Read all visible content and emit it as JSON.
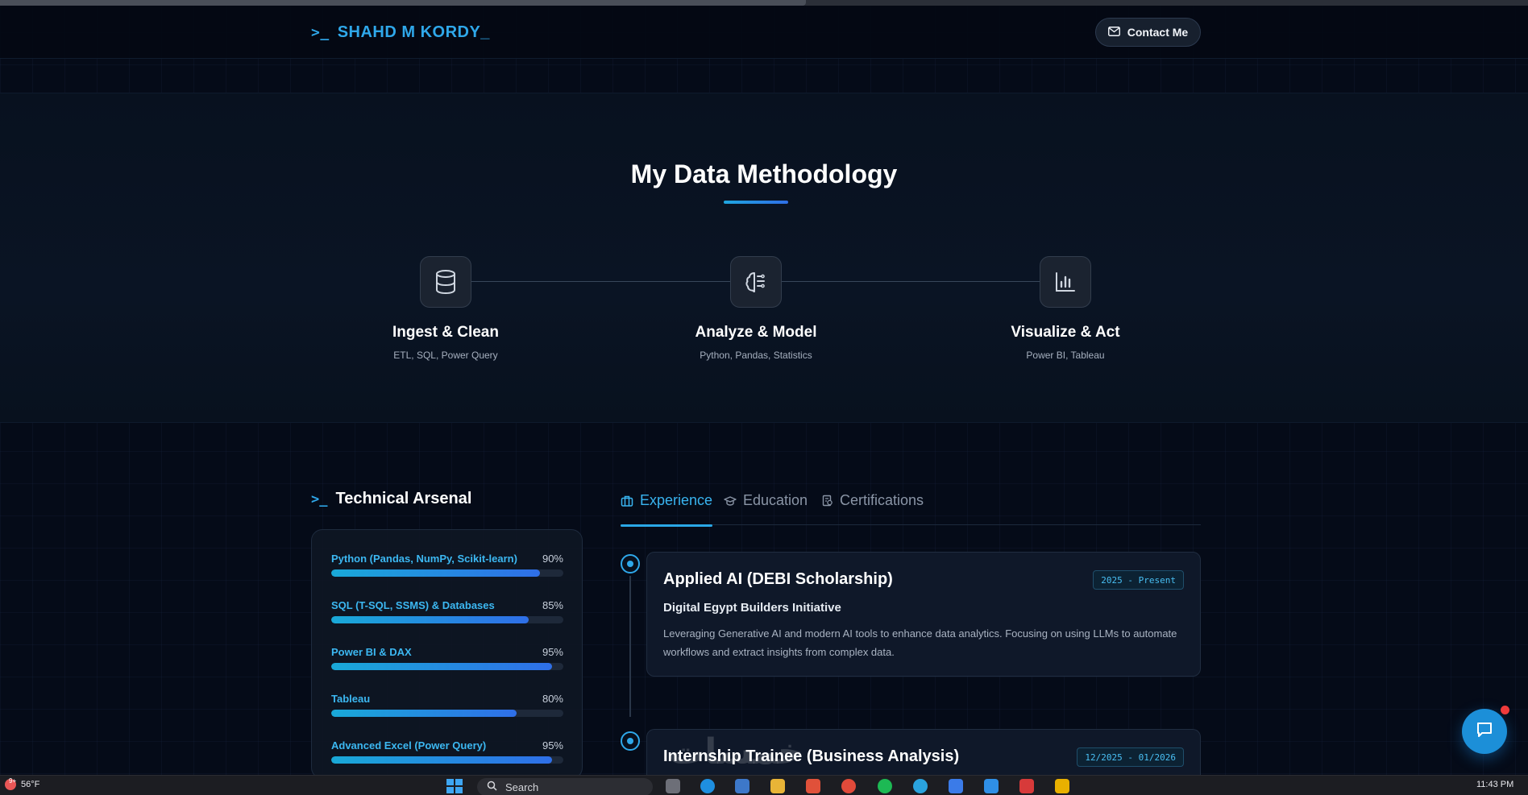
{
  "header": {
    "logo_prompt": ">_",
    "logo_text": "SHAHD M KORDY_",
    "contact_label": "Contact Me"
  },
  "methodology": {
    "title": "My Data Methodology",
    "steps": [
      {
        "title": "Ingest & Clean",
        "subtitle": "ETL, SQL, Power Query",
        "icon": "database-icon"
      },
      {
        "title": "Analyze & Model",
        "subtitle": "Python, Pandas, Statistics",
        "icon": "brain-icon"
      },
      {
        "title": "Visualize & Act",
        "subtitle": "Power BI, Tableau",
        "icon": "bar-chart-icon"
      }
    ]
  },
  "arsenal": {
    "prompt": ">_",
    "title": "Technical Arsenal",
    "skills": [
      {
        "name": "Python (Pandas, NumPy, Scikit-learn)",
        "percent_label": "90%",
        "level": 90
      },
      {
        "name": "SQL (T-SQL, SSMS) & Databases",
        "percent_label": "85%",
        "level": 85
      },
      {
        "name": "Power BI & DAX",
        "percent_label": "95%",
        "level": 95
      },
      {
        "name": "Tableau",
        "percent_label": "80%",
        "level": 80
      },
      {
        "name": "Advanced Excel (Power Query)",
        "percent_label": "95%",
        "level": 95
      }
    ]
  },
  "tabs": [
    {
      "label": "Experience",
      "icon": "briefcase-icon",
      "active": true
    },
    {
      "label": "Education",
      "icon": "graduation-cap-icon",
      "active": false
    },
    {
      "label": "Certifications",
      "icon": "certificate-icon",
      "active": false
    }
  ],
  "experience": [
    {
      "title": "Applied AI (DEBI Scholarship)",
      "date": "2025 - Present",
      "org": "Digital Egypt Builders Initiative",
      "description": "Leveraging Generative AI and modern AI tools to enhance data analytics. Focusing on using LLMs to automate workflows and extract insights from complex data."
    },
    {
      "title": "Internship Trainee (Business Analysis)",
      "date": "12/2025 - 01/2026"
    }
  ],
  "watermark": "خمسات",
  "taskbar": {
    "weather": "56°F",
    "search_label": "Search",
    "clock": "11:43 PM"
  },
  "colors": {
    "accent": "#2fa8ea",
    "background": "#050b18",
    "card": "#0f1829"
  }
}
